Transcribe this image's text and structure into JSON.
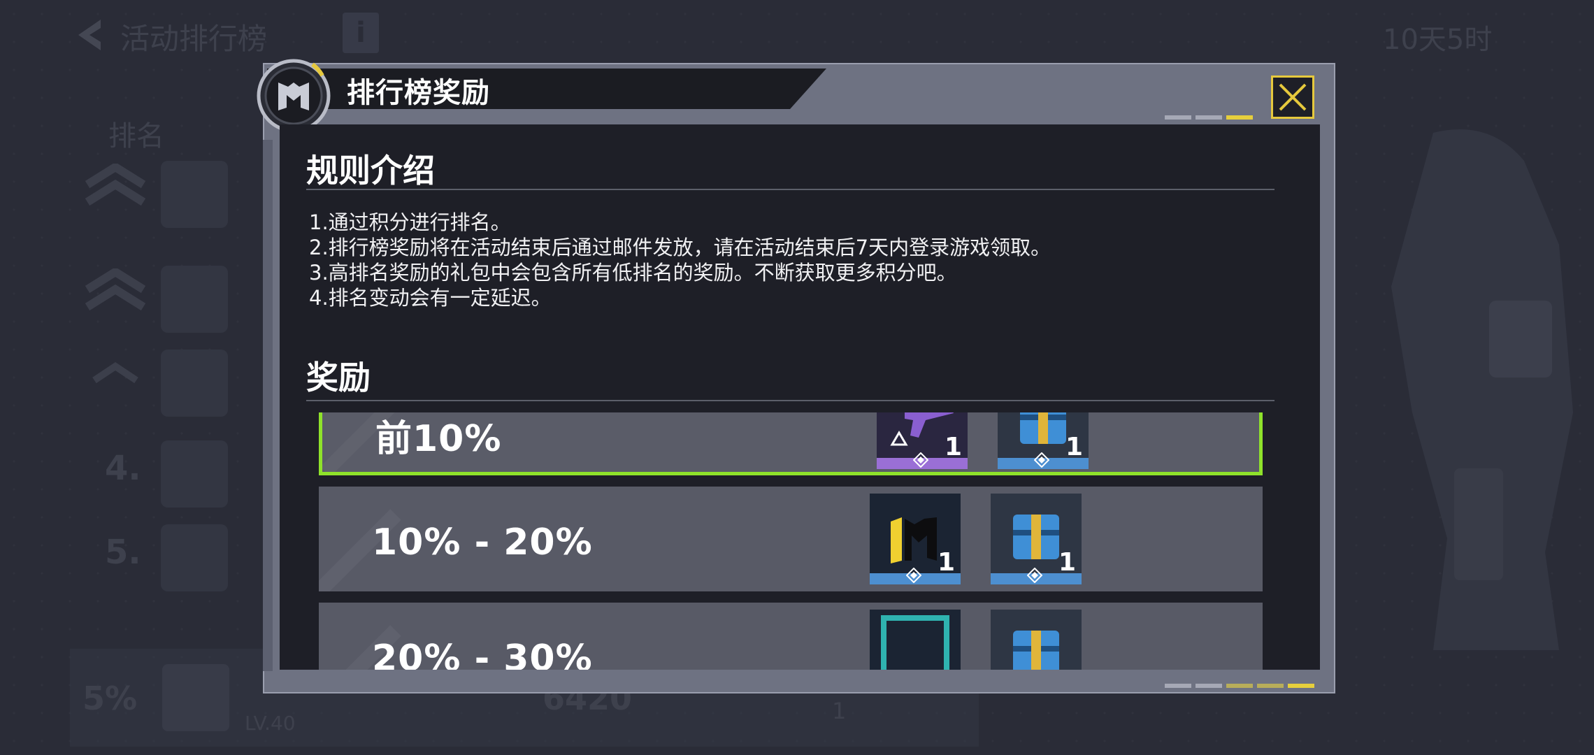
{
  "background": {
    "title": "活动排行榜",
    "info_label": "i",
    "timer": "10天5时",
    "rank_header": "排名",
    "rows": [
      {
        "num": ""
      },
      {
        "num": ""
      },
      {
        "num": ""
      },
      {
        "num": "4."
      },
      {
        "num": "5."
      }
    ],
    "my_row": {
      "percent": "5%",
      "level": "LV.40",
      "score": "6420",
      "count": "1"
    }
  },
  "dialog": {
    "title": "排行榜奖励",
    "rules_section": {
      "heading": "规则介绍",
      "items": [
        "1.通过积分进行排名。",
        "2.排行榜奖励将在活动结束后通过邮件发放，请在活动结束后7天内登录游戏领取。",
        "3.高排名奖励的礼包中会包含所有低排名的奖励。不断获取更多积分吧。",
        "4.排名变动会有一定延迟。"
      ]
    },
    "rewards_section": {
      "heading": "奖励",
      "tiers": [
        {
          "range": "前10%",
          "items": [
            {
              "icon": "weapon-blueprint-icon",
              "qty": "1",
              "rarity_color": "#9a6fd6"
            },
            {
              "icon": "supply-crate-icon",
              "qty": "1",
              "rarity_color": "#4d8fd0"
            }
          ]
        },
        {
          "range": "10% - 20%",
          "items": [
            {
              "icon": "codm-emblem-icon",
              "qty": "1",
              "rarity_color": "#4d8fd0"
            },
            {
              "icon": "supply-crate-icon",
              "qty": "1",
              "rarity_color": "#4d8fd0"
            }
          ]
        },
        {
          "range": "20% - 30%",
          "items": [
            {
              "icon": "frame-icon",
              "qty": "",
              "rarity_color": "#4d8fd0"
            },
            {
              "icon": "supply-crate-icon",
              "qty": "",
              "rarity_color": "#4d8fd0"
            }
          ]
        }
      ]
    }
  },
  "colors": {
    "selected_border": "#8fe22b",
    "accent_yellow": "#e6c93d",
    "panel_bg": "#1e1f27"
  }
}
